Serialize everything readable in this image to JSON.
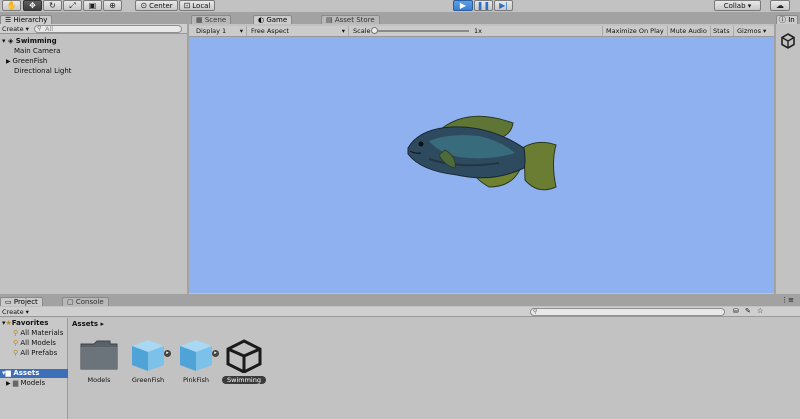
{
  "toolbar": {
    "tools": [
      {
        "name": "hand-tool",
        "glyph": "✋"
      },
      {
        "name": "move-tool",
        "glyph": "✥"
      },
      {
        "name": "rotate-tool",
        "glyph": "↻"
      },
      {
        "name": "scale-tool",
        "glyph": "⤢"
      },
      {
        "name": "rect-tool",
        "glyph": "▣"
      },
      {
        "name": "transform-tool",
        "glyph": "⊕"
      }
    ],
    "pivot_label": "Center",
    "space_label": "Local",
    "collab_label": "Collab ▾"
  },
  "hierarchy": {
    "tab_label": "Hierarchy",
    "create_label": "Create ▾",
    "search_placeholder": "All",
    "scene_name": "Swimming",
    "items": [
      "Main Camera",
      "GreenFish",
      "Directional Light"
    ]
  },
  "center_tabs": [
    "Scene",
    "Game",
    "Asset Store"
  ],
  "game": {
    "display": "Display 1",
    "aspect": "Free Aspect",
    "scale_label": "Scale",
    "scale_value": "1x",
    "maximize": "Maximize On Play",
    "mute": "Mute Audio",
    "stats": "Stats",
    "gizmos": "Gizmos ▾",
    "background_color": "#8fb1ef"
  },
  "inspector": {
    "tab_label": "In"
  },
  "project": {
    "tabs": [
      "Project",
      "Console"
    ],
    "create_label": "Create ▾",
    "favorites_label": "Favorites",
    "favorites": [
      "All Materials",
      "All Models",
      "All Prefabs"
    ],
    "assets_root": "Assets",
    "assets_children": [
      "Models"
    ],
    "breadcrumb": "Assets ▸",
    "assets": [
      {
        "label": "Models",
        "type": "folder"
      },
      {
        "label": "GreenFish",
        "type": "prefab"
      },
      {
        "label": "PinkFish",
        "type": "prefab"
      },
      {
        "label": "Swimming",
        "type": "scene",
        "selected": true
      }
    ]
  }
}
